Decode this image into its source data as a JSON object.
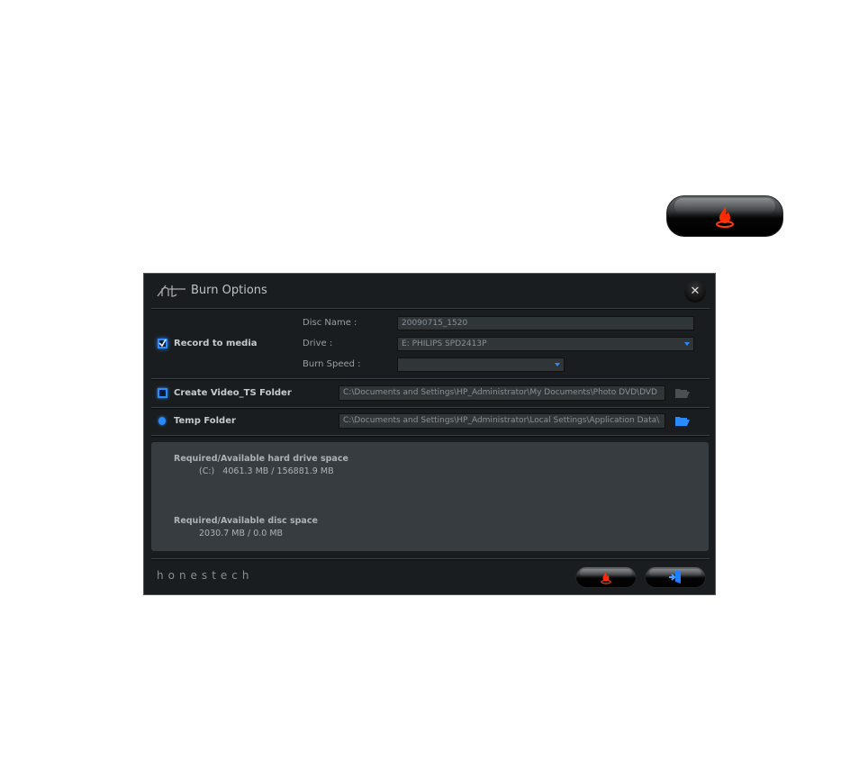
{
  "top_burn_button": {
    "icon": "flame-icon"
  },
  "dialog": {
    "title": "Burn Options",
    "logo": "ht",
    "close_icon": "close-icon",
    "record": {
      "label": "Record to media",
      "checked": true,
      "disc_name_label": "Disc Name :",
      "disc_name_value": "20090715_1520",
      "drive_label": "Drive :",
      "drive_value": "E: PHILIPS  SPD2413P",
      "speed_label": "Burn Speed :",
      "speed_value": ""
    },
    "video_ts": {
      "label": "Create Video_TS Folder",
      "checked": false,
      "path": "C:\\Documents and Settings\\HP_Administrator\\My Documents\\Photo DVD\\DVD"
    },
    "temp": {
      "label": "Temp Folder",
      "path": "C:\\Documents and Settings\\HP_Administrator\\Local Settings\\Application Data\\"
    },
    "info": {
      "hd_title": "Required/Available hard drive space",
      "hd_value": "(C:)   4061.3 MB / 156881.9 MB",
      "disc_title": "Required/Available disc space",
      "disc_value": "2030.7 MB / 0.0 MB"
    },
    "brand": "honestech",
    "buttons": [
      {
        "icon": "flame-icon"
      },
      {
        "icon": "exit-door-icon"
      }
    ],
    "colors": {
      "accent": "#2a8bff",
      "flame": "#ff2a00"
    }
  }
}
